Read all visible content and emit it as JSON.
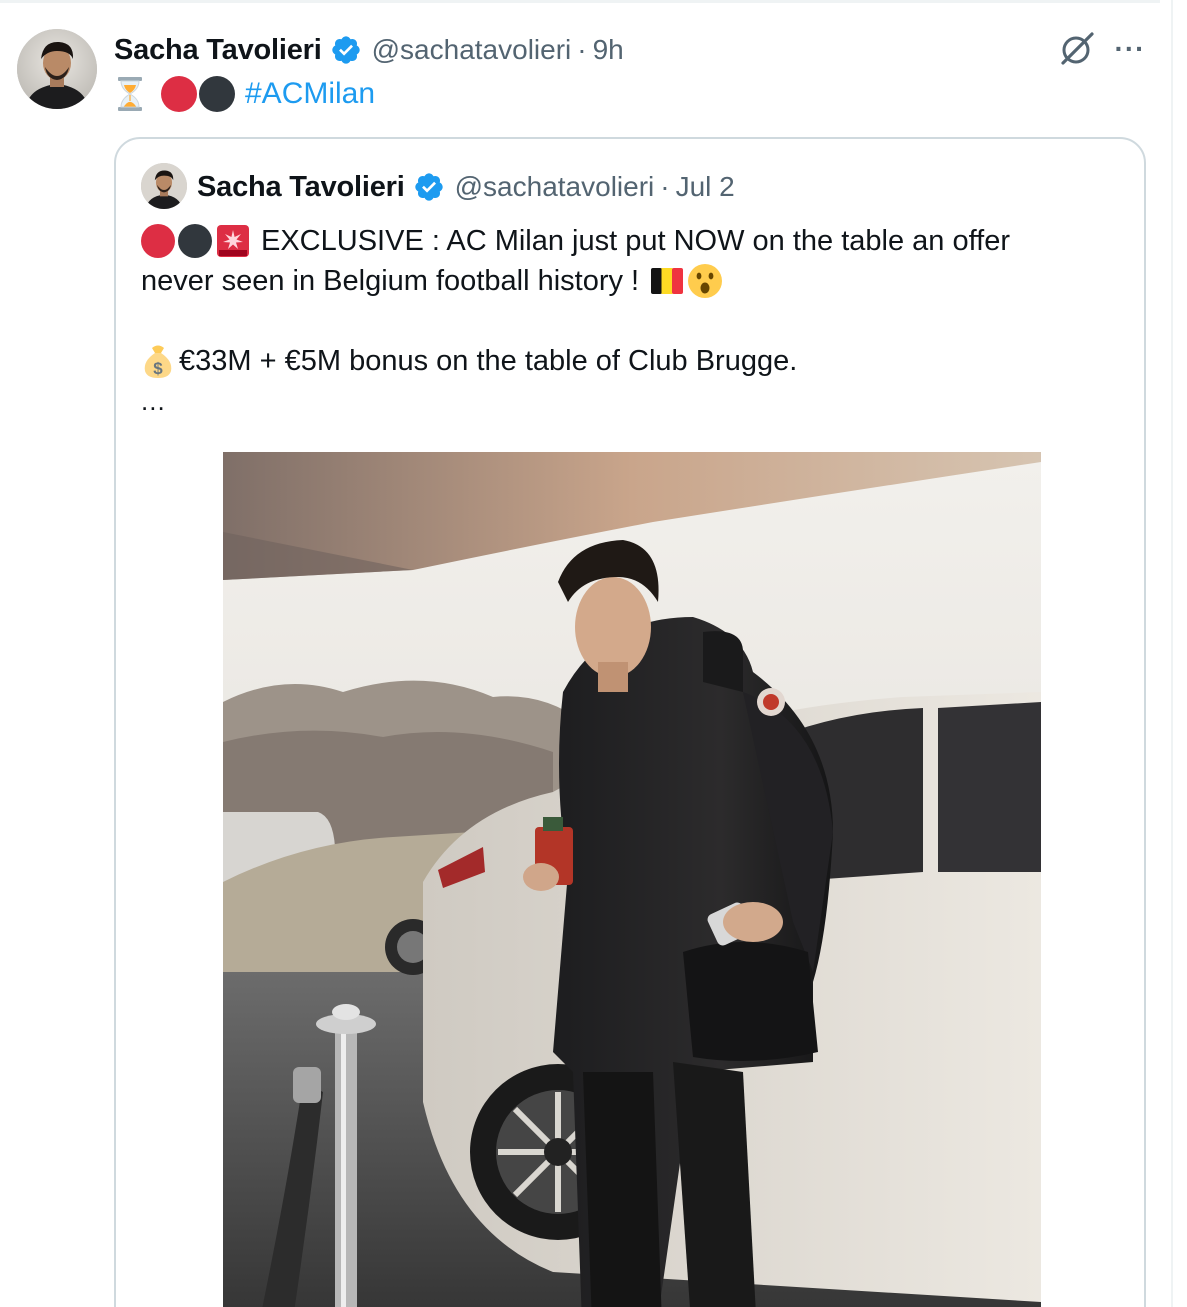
{
  "tweet": {
    "display_name": "Sacha Tavolieri",
    "handle": "@sachatavolieri",
    "separator": "·",
    "time": "9h",
    "hashtag": "#ACMilan",
    "icons": [
      "hourglass-icon",
      "red-circle-icon",
      "black-circle-icon"
    ],
    "actions": {
      "grok_icon": "grok-icon",
      "more_label": "···"
    }
  },
  "quoted_tweet": {
    "display_name": "Sacha Tavolieri",
    "handle": "@sachatavolieri",
    "separator": "·",
    "time": "Jul 2",
    "line1": "EXCLUSIVE : AC Milan just put NOW on the table an offer",
    "line2": "never seen in Belgium football history !",
    "line3": "€33M + €5M bonus on the table of Club Brugge.",
    "truncation": "...",
    "media": "photo"
  },
  "colors": {
    "accent": "#1d9bf0",
    "text_primary": "#0f1419",
    "text_secondary": "#536471",
    "border": "#cfd9de",
    "red_circle": "#dd2e44",
    "black_circle": "#31373d"
  }
}
